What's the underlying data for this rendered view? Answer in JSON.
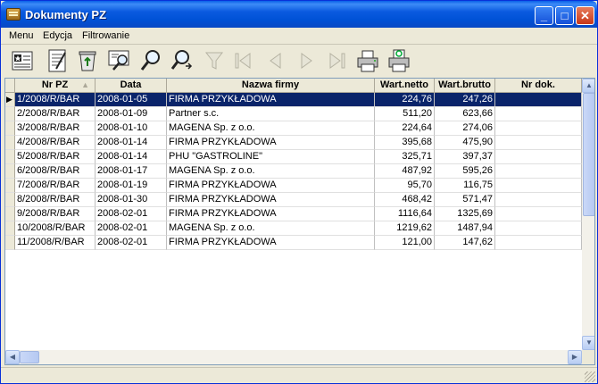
{
  "window": {
    "title": "Dokumenty PZ"
  },
  "menu": [
    "Menu",
    "Edycja",
    "Filtrowanie"
  ],
  "toolbar": [
    {
      "icon": "card-icon",
      "enabled": true
    },
    {
      "icon": "edit-document-icon",
      "enabled": true
    },
    {
      "icon": "recycle-icon",
      "enabled": true
    },
    {
      "icon": "preview-icon",
      "enabled": true
    },
    {
      "icon": "search-icon",
      "enabled": true
    },
    {
      "icon": "search-next-icon",
      "enabled": true
    },
    {
      "icon": "filter-icon",
      "enabled": false
    },
    {
      "icon": "first-record-icon",
      "enabled": false
    },
    {
      "icon": "previous-record-icon",
      "enabled": false
    },
    {
      "icon": "next-record-icon",
      "enabled": false
    },
    {
      "icon": "last-record-icon",
      "enabled": false
    },
    {
      "icon": "printer-icon",
      "enabled": true
    },
    {
      "icon": "print-preview-icon",
      "enabled": true
    }
  ],
  "columns": [
    "Nr PZ",
    "Data",
    "Nazwa firmy",
    "Wart.netto",
    "Wart.brutto",
    "Nr dok."
  ],
  "rows": [
    [
      "1/2008/R/BAR",
      "2008-01-05",
      "FIRMA PRZYKŁADOWA",
      "224,76",
      "247,26",
      ""
    ],
    [
      "2/2008/R/BAR",
      "2008-01-09",
      "Partner s.c.",
      "511,20",
      "623,66",
      ""
    ],
    [
      "3/2008/R/BAR",
      "2008-01-10",
      "MAGENA Sp. z o.o.",
      "224,64",
      "274,06",
      ""
    ],
    [
      "4/2008/R/BAR",
      "2008-01-14",
      "FIRMA PRZYKŁADOWA",
      "395,68",
      "475,90",
      ""
    ],
    [
      "5/2008/R/BAR",
      "2008-01-14",
      "PHU \"GASTROLINE\"",
      "325,71",
      "397,37",
      ""
    ],
    [
      "6/2008/R/BAR",
      "2008-01-17",
      "MAGENA Sp. z o.o.",
      "487,92",
      "595,26",
      ""
    ],
    [
      "7/2008/R/BAR",
      "2008-01-19",
      "FIRMA PRZYKŁADOWA",
      "95,70",
      "116,75",
      ""
    ],
    [
      "8/2008/R/BAR",
      "2008-01-30",
      "FIRMA PRZYKŁADOWA",
      "468,42",
      "571,47",
      ""
    ],
    [
      "9/2008/R/BAR",
      "2008-02-01",
      "FIRMA PRZYKŁADOWA",
      "1116,64",
      "1325,69",
      ""
    ],
    [
      "10/2008/R/BAR",
      "2008-02-01",
      "MAGENA Sp. z o.o.",
      "1219,62",
      "1487,94",
      ""
    ],
    [
      "11/2008/R/BAR",
      "2008-02-01",
      "FIRMA PRZYKŁADOWA",
      "121,00",
      "147,62",
      ""
    ]
  ],
  "selected_row": 0,
  "colors": {
    "title_bar": "#0052d6",
    "selection": "#0a246a",
    "window_bg": "#ece9d8"
  }
}
